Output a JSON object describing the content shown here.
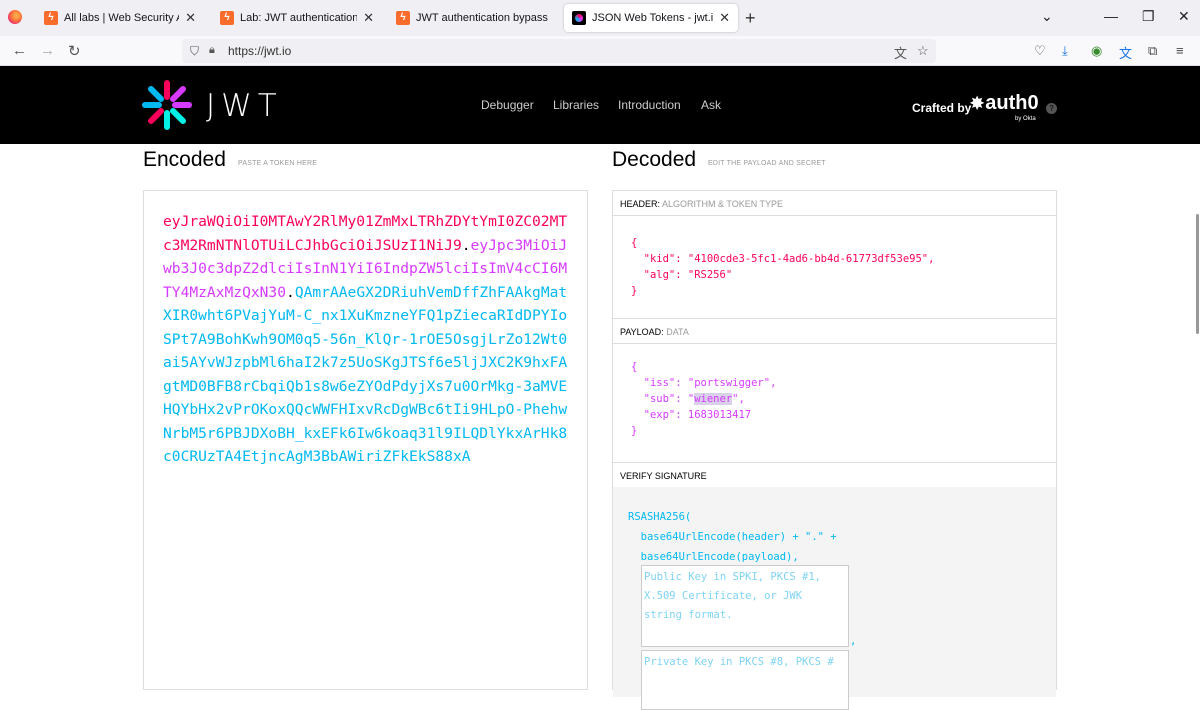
{
  "browser": {
    "tabs": [
      {
        "label": "All labs | Web Security Academy",
        "icon": "portswigger-icon",
        "active": false
      },
      {
        "label": "Lab: JWT authentication bypass",
        "icon": "portswigger-icon",
        "active": false
      },
      {
        "label": "JWT authentication bypass via fl",
        "icon": "portswigger-icon",
        "active": false
      },
      {
        "label": "JSON Web Tokens - jwt.io",
        "icon": "jwt-icon",
        "active": true
      }
    ],
    "url": "https://jwt.io",
    "close_glyph": "✕",
    "new_tab_glyph": "+"
  },
  "site": {
    "logo_text": "JWT",
    "nav": [
      "Debugger",
      "Libraries",
      "Introduction",
      "Ask"
    ],
    "crafted_by": "Crafted by",
    "brand": "auth0",
    "brand_sub": "by Okta",
    "colors": {
      "header_part": "#fb015b",
      "payload_part": "#d63aff",
      "signature_part": "#00b9f1"
    }
  },
  "encoded": {
    "title": "Encoded",
    "subtitle": "PASTE A TOKEN HERE",
    "header_part": "eyJraWQiOiI0MTAwY2RlMy01ZmMxLTRhZDYtYmI0ZC02MTc3M2RmNTNlOTUiLCJhbGciOiJSUzI1NiJ9",
    "payload_part": "eyJpc3MiOiJwb3J0c3dpZ2dlciIsInN1YiI6IndpZW5lciIsImV4cCI6MTY4MzAxMzQxN30",
    "signature_part": "QAmrAAeGX2DRiuhVemDffZhFAAkgMatXIR0wht6PVajYuM-C_nx1XuKmzneYFQ1pZiecaRIdDPYIoSPt7A9BohKwh9OM0q5-56n_KlQr-1rOE5OsgjLrZo12Wt0ai5AYvWJzpbMl6haI2k7z5UoSKgJTSf6e5ljJXC2K9hxFAgtMD0BFB8rCbqiQb1s8w6eZYOdPdyjXs7u0OrMkg-3aMVEHQYbHx2vPrOKoxQQcWWFHIxvRcDgWBc6tIi9HLpO-PhehwNrbM5r6PBJDXoBH_kxEFk6Iw6koaq31l9ILQDlYkxArHk8c0CRUzTA4EtjncAgM3BbAWiriZFkEkS88xA",
    "dot": "."
  },
  "decoded": {
    "title": "Decoded",
    "subtitle": "EDIT THE PAYLOAD AND SECRET",
    "header_label": "HEADER:",
    "header_hint": "ALGORITHM & TOKEN TYPE",
    "header_lines": [
      "{",
      "  \"kid\": \"4100cde3-5fc1-4ad6-bb4d-61773df53e95\",",
      "  \"alg\": \"RS256\"",
      "}"
    ],
    "payload_label": "PAYLOAD:",
    "payload_hint": "DATA",
    "payload_open": "{",
    "payload_iss": "  \"iss\": \"portswigger\",",
    "payload_sub_pre": "  \"sub\": \"",
    "payload_sub_val": "wiener",
    "payload_sub_post": "\",",
    "payload_exp": "  \"exp\": 1683013417",
    "payload_close": "}",
    "verify_label": "VERIFY SIGNATURE",
    "verify_lines": [
      "RSASHA256(",
      "  base64UrlEncode(header) + \".\" +",
      "  base64UrlEncode(payload),"
    ],
    "public_key_placeholder": "Public Key in SPKI, PKCS #1, X.509 Certificate, or JWK string format.",
    "private_key_placeholder": "Private Key in PKCS #8, PKCS #",
    "comma": ","
  }
}
